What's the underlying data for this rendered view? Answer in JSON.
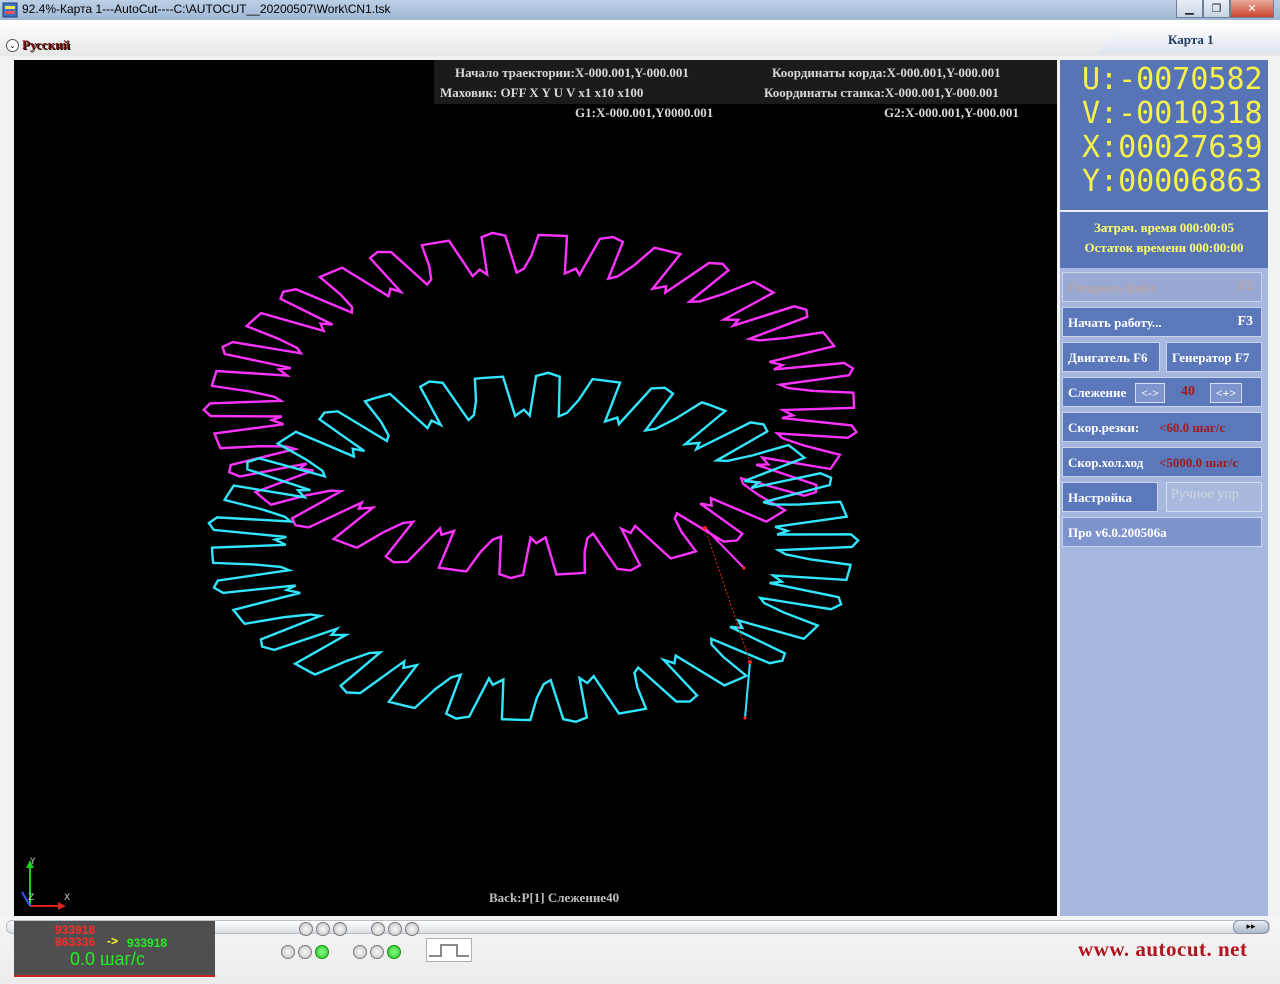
{
  "window": {
    "title": "92.4%-Карта 1---AutoCut----C:\\AUTOCUT__20200507\\Work\\CN1.tsk",
    "minimize_icon": "minimize-icon",
    "restore_icon": "restore-icon",
    "close_icon": "close-icon"
  },
  "menubar": {
    "language": "Русский",
    "card_tab": "Карта 1"
  },
  "canvas": {
    "info": {
      "start_traj": "Начало траектории:X-000.001,Y-000.001",
      "chord_coords": "Координаты корда:X-000.001,Y-000.001",
      "handwheel": "Маховик:  OFF  X  Y  U  V   x1  x10   x100",
      "machine_coords": "Координаты станка:X-000.001,Y-000.001",
      "g1": "G1:X-000.001,Y0000.001",
      "g2": "G2:X-000.001,Y-000.001"
    },
    "status": "Back:P[1] Слежение40",
    "axis_labels": {
      "y": "Y",
      "x": "X",
      "z": "Z"
    },
    "colors": {
      "outer_gear": "#ff33ff",
      "inner_gear": "#33e6ff",
      "path": "#ff2222"
    }
  },
  "panel": {
    "coords": {
      "u": "U:-0070582",
      "v": "V:-0010318",
      "x": "X:00027639",
      "y": "Y:00006863"
    },
    "time": {
      "elapsed": "Затрач. время 000:00:05",
      "remaining": "Остаток времени 000:00:00"
    },
    "buttons": {
      "open_file": {
        "label": "Открыть файл",
        "key": "F2"
      },
      "start_work": {
        "label": "Начать работу...",
        "key": "F3"
      },
      "motor": "Двигатель F6",
      "generator": "Генератор F7",
      "tracking": "Слежение",
      "tracking_minus": "<->",
      "tracking_value": "40",
      "tracking_plus": "<+>",
      "cut_speed": "Скор.резки:",
      "cut_speed_value": "<60.0 шаг/с",
      "idle_speed": "Скор.хол.ход",
      "idle_speed_value": "<5000.0 шаг/с",
      "settings": "Настройка",
      "manual": "Ручное упр",
      "version": "Про v6.0.200506a"
    }
  },
  "bottom": {
    "counter_top": "933918",
    "counter_mid": "863336",
    "counter_arrow": "->",
    "counter_right": "933918",
    "speed": "0.0 шаг/с",
    "website": "www. autocut. net",
    "scroll_arrow": "▸▸"
  }
}
